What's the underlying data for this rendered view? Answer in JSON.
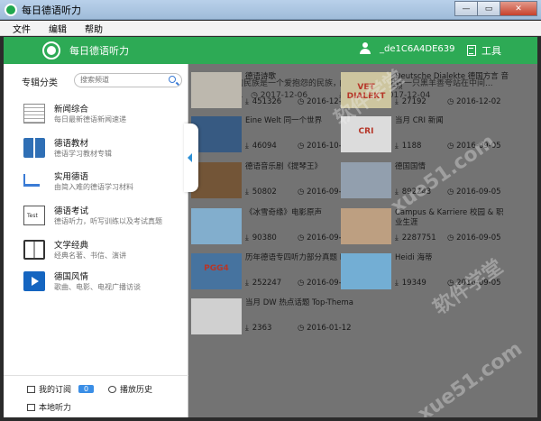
{
  "window": {
    "title": "每日德语听力",
    "min": "—",
    "max": "▭",
    "close": "✕"
  },
  "menu": [
    "文件",
    "编辑",
    "帮助"
  ],
  "header": {
    "app_title": "每日德语听力",
    "username": "_de1C6A4DE639",
    "tools_label": "工具"
  },
  "sidebar": {
    "heading": "专辑分类",
    "search_placeholder": "搜索频道",
    "categories": [
      {
        "name": "新闻综合",
        "desc": "每日最新德语新闻速递",
        "icon": "newspaper-icon"
      },
      {
        "name": "德语教材",
        "desc": "德语学习教材专辑",
        "icon": "book-icon"
      },
      {
        "name": "实用德语",
        "desc": "由简入难的德语学习材料",
        "icon": "cart-icon"
      },
      {
        "name": "德语考试",
        "desc": "德语听力，听写训练以及考试真题",
        "icon": "exam-icon"
      },
      {
        "name": "文学经典",
        "desc": "经典名著、书信、演讲",
        "icon": "open-book-icon"
      },
      {
        "name": "德国风情",
        "desc": "歌曲、电影、电视广播访谈",
        "icon": "film-icon"
      }
    ],
    "footer": {
      "subscriptions": "我的订阅",
      "sub_count": "0",
      "history": "播放历史",
      "local": "本地听力"
    }
  },
  "top_row": [
    {
      "text": "被遗忘的民族是一个爱抱怨的民族，那你...",
      "downloads": "10531",
      "date": "2017-12-06"
    },
    {
      "text": "白花花的羊群里，一只黑羊善夸站在中间...",
      "downloads": "2940",
      "date": "2017-12-04"
    }
  ],
  "cards": [
    {
      "title": "德语诗歌",
      "downloads": "451326",
      "date": "2016-12-02",
      "thumb": "#c8c2b8"
    },
    {
      "title": "Deutsche Dialekte 德国方言 音频",
      "downloads": "27192",
      "date": "2016-12-02",
      "thumb": "#d8d0a8",
      "thumb_text": "VET DIALEKT"
    },
    {
      "title": "Eine Welt 同一个世界",
      "downloads": "46094",
      "date": "2016-10-26",
      "thumb": "#3a5f8a"
    },
    {
      "title": "当月 CRI 新闻",
      "downloads": "1188",
      "date": "2016-09-05",
      "thumb": "#e8e8e8",
      "thumb_text": "CRI"
    },
    {
      "title": "德语音乐剧《提琴王》",
      "downloads": "50802",
      "date": "2016-09-05",
      "thumb": "#7a5a3a"
    },
    {
      "title": "德国国情",
      "downloads": "892243",
      "date": "2016-09-05",
      "thumb": "#9aa8b8"
    },
    {
      "title": "《冰雪奇缘》电影原声",
      "downloads": "90380",
      "date": "2016-09-05",
      "thumb": "#8ab8d8"
    },
    {
      "title": "Campus & Karriere 校园 & 职业生涯",
      "downloads": "2287751",
      "date": "2016-09-05",
      "thumb": "#c8a888"
    },
    {
      "title": "历年德语专四听力部分真题 PGG",
      "downloads": "252247",
      "date": "2016-09-05",
      "thumb": "#4a7aa8",
      "thumb_text": "PGG4"
    },
    {
      "title": "Heidi 海蒂",
      "downloads": "19349",
      "date": "2016-09-05",
      "thumb": "#7ab8e0"
    },
    {
      "title": "当月 DW 热点话题 Top-Thema",
      "downloads": "2363",
      "date": "2016-01-12",
      "thumb": "#dcdcdc"
    }
  ],
  "colors": {
    "header_green": "#2daa55",
    "badge_blue": "#3a8ee6"
  }
}
